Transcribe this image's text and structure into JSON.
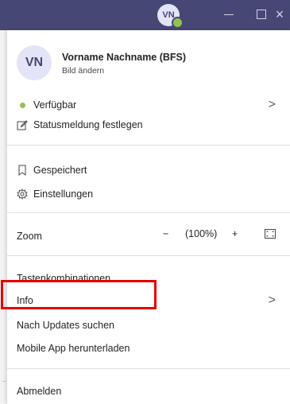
{
  "titlebar": {
    "avatar_initials": "VN",
    "presence_color": "#92c353",
    "minimize_icon": "minimize-icon",
    "maximize_icon": "maximize-icon",
    "close_icon": "close-icon",
    "close_glyph": "×",
    "background": "#464775"
  },
  "profile": {
    "initials": "VN",
    "name": "Vorname Nachname (BFS)",
    "change_picture": "Bild ändern"
  },
  "status": {
    "label": "Verfügbar",
    "color": "#92c353",
    "status_message": "Statusmeldung festlegen"
  },
  "menu": {
    "saved": "Gespeichert",
    "settings": "Einstellungen",
    "zoom_label": "Zoom",
    "zoom_minus": "−",
    "zoom_value": "(100%)",
    "zoom_plus": "+",
    "shortcuts": "Tastenkombinationen",
    "info": "Info",
    "check_updates": "Nach Updates suchen",
    "download_mobile": "Mobile App herunterladen",
    "sign_out": "Abmelden",
    "chevron": ">"
  },
  "highlight": {
    "color": "#e60000"
  }
}
